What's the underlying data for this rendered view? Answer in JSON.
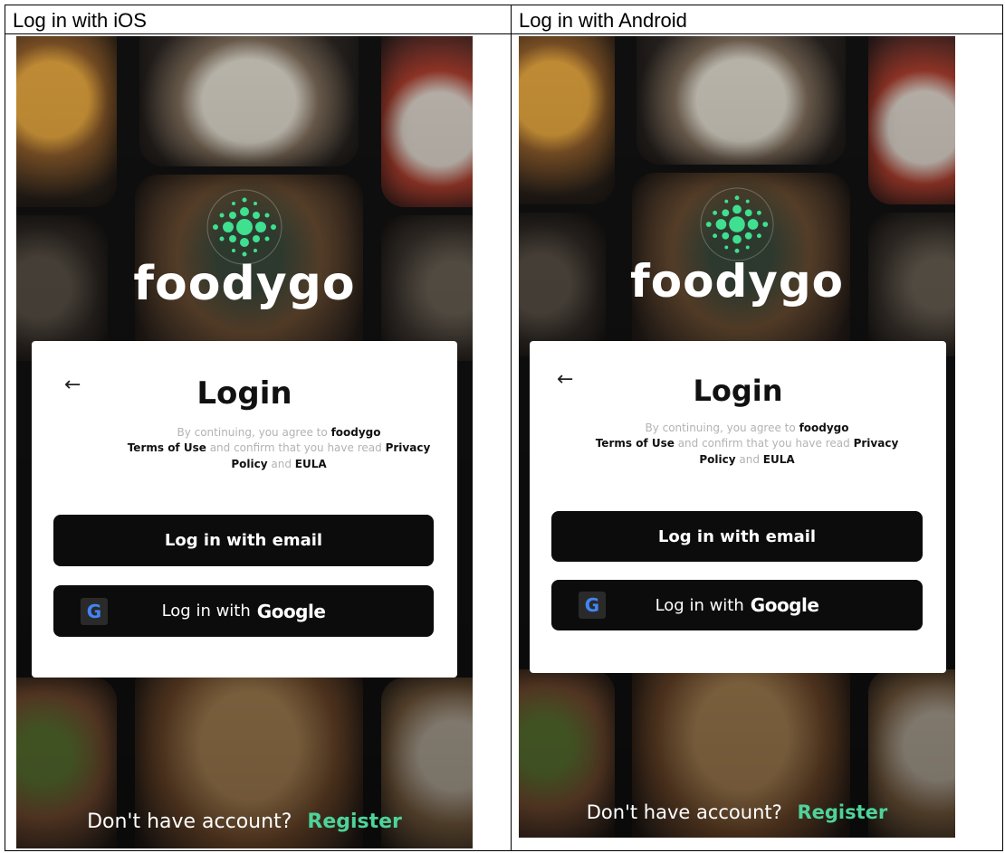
{
  "columns": [
    {
      "header": "Log in with iOS"
    },
    {
      "header": "Log in with Android"
    }
  ],
  "app": {
    "brand": "foodygo",
    "login_title": "Login",
    "back_icon": "←",
    "terms": {
      "prefix": "By continuing, you agree to",
      "brand": "foodygo",
      "terms_link": "Terms of Use",
      "middle": "and confirm that you have read",
      "privacy_link": "Privacy Policy",
      "and": "and",
      "eula_link": "EULA"
    },
    "email_button": "Log in with email",
    "google_button_prefix": "Log in with",
    "google_word": "Google",
    "google_icon_letter": "G",
    "footer_question": "Don't have account?",
    "footer_register": "Register"
  },
  "colors": {
    "accent_green": "#4ed39a",
    "logo_green": "#3fe08f",
    "button_black": "#0c0c0c"
  },
  "icons": [
    "back-arrow-icon",
    "google-icon",
    "foodygo-logo-icon"
  ]
}
